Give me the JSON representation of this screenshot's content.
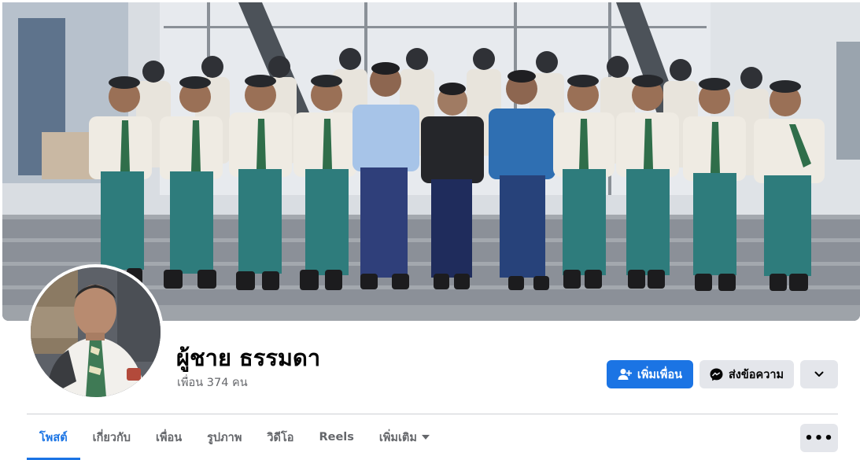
{
  "profile": {
    "name": "ผู้ชาย ธรรมดา",
    "friends_count": "เพื่อน 374 คน"
  },
  "actions": {
    "add_friend": "เพิ่มเพื่อน",
    "message": "ส่งข้อความ"
  },
  "tabs": [
    {
      "label": "โพสต์",
      "active": true
    },
    {
      "label": "เกี่ยวกับ",
      "active": false
    },
    {
      "label": "เพื่อน",
      "active": false
    },
    {
      "label": "รูปภาพ",
      "active": false
    },
    {
      "label": "วิดีโอ",
      "active": false
    },
    {
      "label": "Reels",
      "active": false
    },
    {
      "label": "เพิ่มเติม",
      "active": false
    }
  ],
  "icons": {
    "add_friend": "person-add-icon",
    "message": "messenger-icon",
    "more": "chevron-down-icon",
    "tab_more": "ellipsis-icon"
  },
  "colors": {
    "accent": "#1b74e4",
    "secondary_button": "#e4e6eb",
    "muted_text": "#65676b"
  }
}
